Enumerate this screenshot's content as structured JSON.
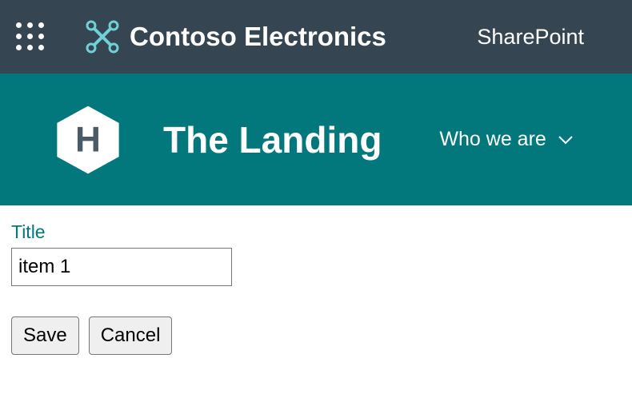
{
  "topBar": {
    "brandName": "Contoso Electronics",
    "productName": "SharePoint"
  },
  "siteHeader": {
    "siteTitle": "The Landing",
    "navItem": "Who we are",
    "hexLetter": "H"
  },
  "form": {
    "titleLabel": "Title",
    "titleValue": "item 1",
    "saveLabel": "Save",
    "cancelLabel": "Cancel"
  }
}
